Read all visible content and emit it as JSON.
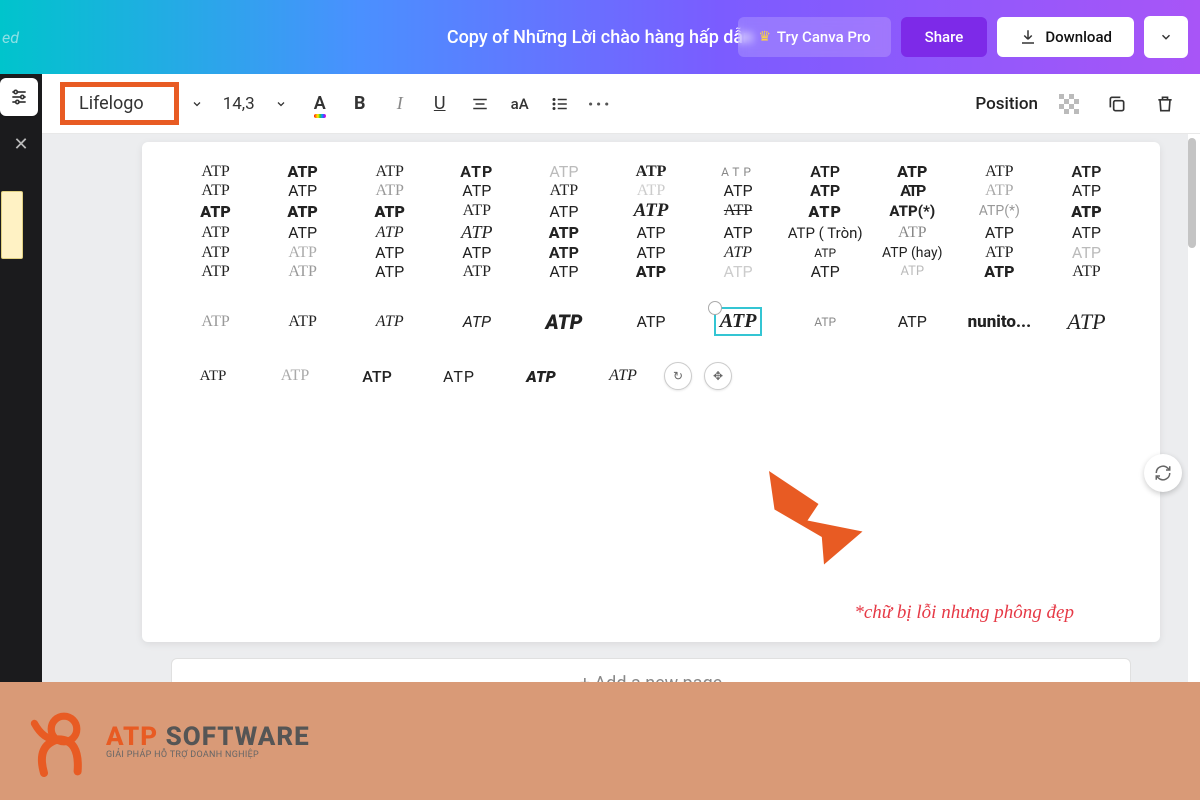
{
  "header": {
    "leftText": "ed",
    "title": "Copy of Những Lời chào hàng hấp dẫn",
    "tryPro": "Try Canva Pro",
    "share": "Share",
    "download": "Download"
  },
  "toolbar": {
    "fontName": "Lifelogo",
    "fontSize": "14,3",
    "positionLabel": "Position"
  },
  "grid": {
    "sample": "ATP",
    "tron": "ATP ( Tròn)",
    "hay": "ATP (hay)",
    "nunito": "nunito...",
    "star1": "ATP(*)",
    "star2": "ATP(*)"
  },
  "annotation": "*chữ bị lỗi nhưng phông đẹp",
  "addPage": "+ Add a new page",
  "footer": {
    "brandA": "ATP",
    "brandB": " SOFTWARE",
    "tagline": "GIẢI PHÁP HỖ TRỢ DOANH NGHIỆP"
  }
}
